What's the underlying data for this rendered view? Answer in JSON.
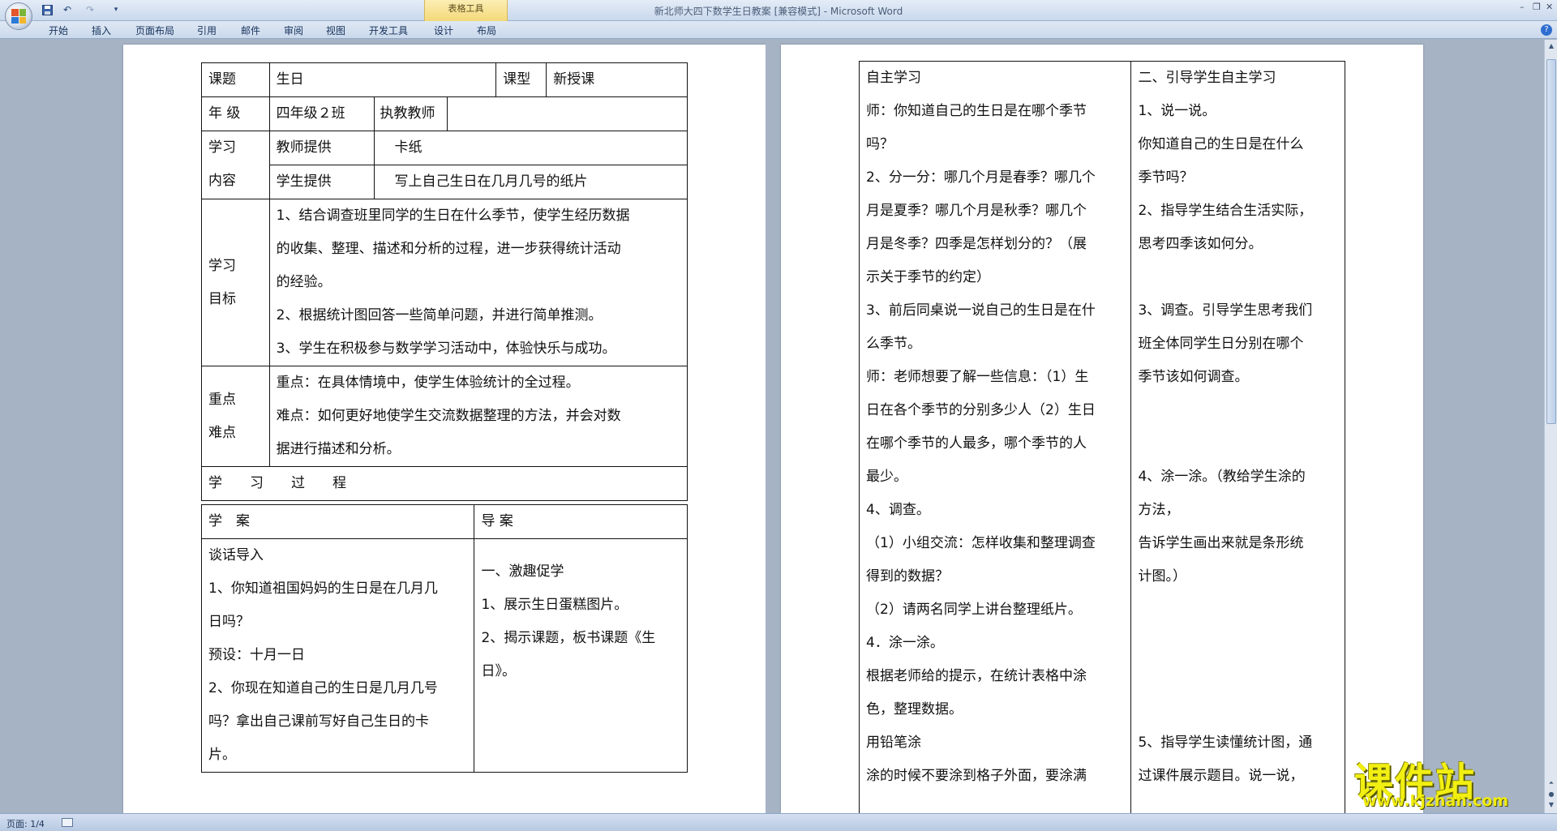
{
  "window": {
    "title": "新北师大四下数学生日教案 [兼容模式] - Microsoft Word",
    "contextual_group": "表格工具",
    "controls": [
      "–",
      "❐",
      "✕"
    ]
  },
  "quick_access": {
    "save_icon": "save-icon",
    "undo_icon": "undo-icon",
    "redo_icon": "redo-icon",
    "customize_icon": "customize-icon"
  },
  "ribbon": {
    "tabs": [
      "开始",
      "插入",
      "页面布局",
      "引用",
      "邮件",
      "审阅",
      "视图",
      "开发工具",
      "设计",
      "布局"
    ],
    "help": "?"
  },
  "page1": {
    "r1": {
      "label": "课题",
      "value": "生日",
      "type_label": "课型",
      "type_value": "新授课"
    },
    "r2": {
      "grade_label": "年 级",
      "grade_value": "四年级２班",
      "teacher_label": "执教教师",
      "teacher_value": ""
    },
    "r3": {
      "label_a": "学习",
      "label_b": "内容",
      "teacher_provides": "教师提供",
      "teacher_item": "卡纸",
      "student_provides": "学生提供",
      "student_item": "写上自己生日在几月几号的纸片"
    },
    "r4": {
      "label_a": "学习",
      "label_b": "目标",
      "lines": [
        "1、结合调查班里同学的生日在什么季节，使学生经历数据",
        "的收集、整理、描述和分析的过程，进一步获得统计活动",
        "的经验。",
        "2、根据统计图回答一些简单问题，并进行简单推测。",
        "3、学生在积极参与数学学习活动中，体验快乐与成功。"
      ]
    },
    "r5": {
      "label_a": "重点",
      "label_b": "难点",
      "lines": [
        "重点：在具体情境中，使学生体验统计的全过程。",
        "难点：如何更好地使学生交流数据整理的方法，并会对数",
        "据进行描述和分析。"
      ]
    },
    "r6": {
      "process": "学　　习　　过　　程"
    },
    "r7": {
      "left_header": "学　案",
      "right_header": "导 案"
    },
    "r8": {
      "left_lines": [
        "谈话导入",
        "1、你知道祖国妈妈的生日是在几月几",
        "日吗？",
        "预设：十月一日",
        "2、你现在知道自己的生日是几月几号",
        "吗？拿出自己课前写好自己生日的卡",
        "片。"
      ],
      "right_lines": [
        "一、激趣促学",
        "1、展示生日蛋糕图片。",
        "2、揭示课题，板书课题《生",
        "日》。",
        "",
        ""
      ]
    }
  },
  "page2": {
    "left_lines": [
      "自主学习",
      "师：你知道自己的生日是在哪个季节",
      "吗？",
      "2、分一分：哪几个月是春季？哪几个",
      "月是夏季？哪几个月是秋季？哪几个",
      "月是冬季？四季是怎样划分的？（展",
      "示关于季节的约定）",
      "3、前后同桌说一说自己的生日是在什",
      "么季节。",
      "师：老师想要了解一些信息：（1）生",
      "日在各个季节的分别多少人（2）生日",
      "在哪个季节的人最多，哪个季节的人",
      "最少。",
      "4、调查。",
      "（1）小组交流：怎样收集和整理调查",
      "得到的数据？",
      "（2）请两名同学上讲台整理纸片。",
      "4．涂一涂。",
      "根据老师给的提示，在统计表格中涂",
      "色，整理数据。",
      "用铅笔涂",
      "涂的时候不要涂到格子外面，要涂满"
    ],
    "right_lines": [
      "二、引导学生自主学习",
      "1、说一说。",
      "你知道自己的生日是在什么",
      "季节吗？",
      "2、指导学生结合生活实际，",
      "思考四季该如何分。",
      "",
      "3、调查。引导学生思考我们",
      "班全体同学生日分别在哪个",
      "季节该如何调查。",
      "",
      "",
      "4、涂一涂。（教给学生涂的",
      "方法，",
      "告诉学生画出来就是条形统",
      "计图。）",
      "",
      "",
      "",
      "",
      "5、指导学生读懂统计图，通",
      "过课件展示题目。说一说，"
    ]
  },
  "statusbar": {
    "page": "页面: 1/4"
  },
  "watermark": {
    "title": "课件站",
    "url": "www.kjzhan.com"
  }
}
